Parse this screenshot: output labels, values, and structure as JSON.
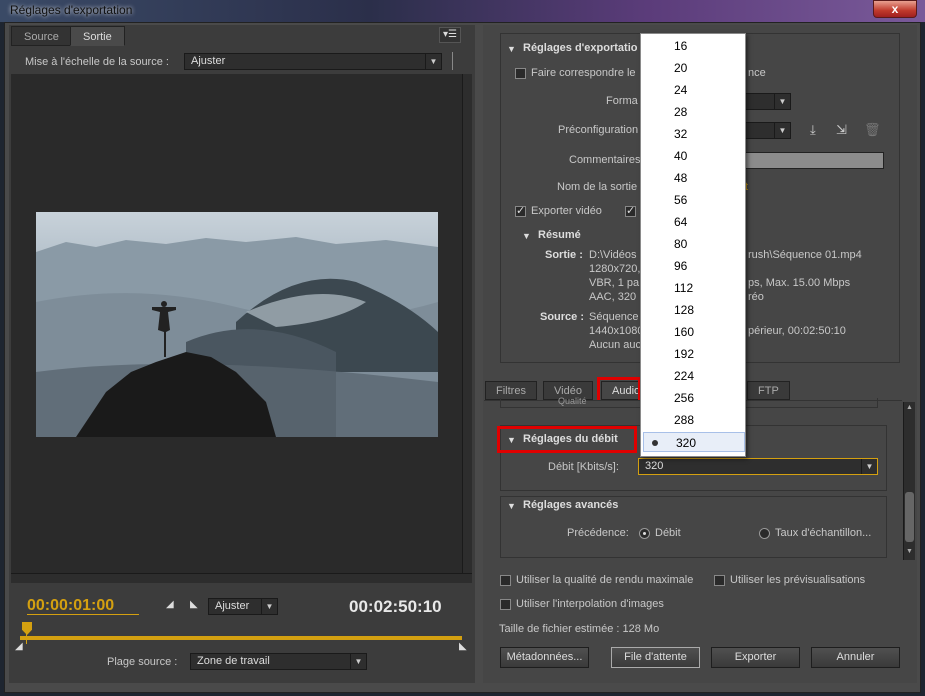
{
  "window": {
    "title": "Réglages d'exportation",
    "close": "x"
  },
  "left": {
    "tabs": [
      "Source",
      "Sortie"
    ],
    "scale_label": "Mise à l'échelle de la source :",
    "scale_value": "Ajuster",
    "timecode_current": "00:00:01:00",
    "timecode_duration": "00:02:50:10",
    "zoom_value": "Ajuster",
    "range_label": "Plage source :",
    "range_value": "Zone de travail"
  },
  "export": {
    "header": "Réglages d'exportatio",
    "match_label": "Faire correspondre le",
    "match_label2": "nce",
    "format_label": "Forma",
    "preset_label": "Préconfiguration",
    "comments_label": "Commentaires",
    "output_name_label": "Nom de la sortie",
    "output_name_val": "t",
    "export_video": "Exporter vidéo",
    "summary_header": "Résumé",
    "output_label": "Sortie :",
    "output_lines": [
      "D:\\Vidéos",
      "1280x720,",
      "VBR, 1 pa",
      "AAC, 320"
    ],
    "output_lines_r": [
      "rush\\Séquence 01.mp4",
      "",
      "ps, Max. 15.00 Mbps",
      "réo"
    ],
    "source_label": "Source :",
    "source_lines": [
      "Séquence",
      "1440x1080",
      "Aucun auc"
    ],
    "source_lines_r": [
      "",
      "périeur, 00:02:50:10",
      ""
    ]
  },
  "tabs2": [
    "Filtres",
    "Vidéo",
    "Audio",
    "FTP"
  ],
  "audio": {
    "cut_label": "Qualité",
    "bitrate_header": "Réglages du débit",
    "bitrate_label": "Débit [Kbits/s]:",
    "bitrate_value": "320",
    "advanced_header": "Réglages avancés",
    "precedence_label": "Précédence:",
    "opt_bitrate": "Débit",
    "opt_sample": "Taux d'échantillon..."
  },
  "popup_items": [
    "16",
    "20",
    "24",
    "28",
    "32",
    "40",
    "48",
    "56",
    "64",
    "80",
    "96",
    "112",
    "128",
    "160",
    "192",
    "224",
    "256",
    "288",
    "320"
  ],
  "popup_selected": "320",
  "bottom": {
    "max_quality": "Utiliser la qualité de rendu maximale",
    "use_previews": "Utiliser les prévisualisations",
    "interp": "Utiliser l'interpolation d'images",
    "filesize": "Taille de fichier estimée : 128 Mo",
    "metadata": "Métadonnées...",
    "queue": "File d'attente",
    "export": "Exporter",
    "cancel": "Annuler"
  },
  "colors": {
    "timecode": "#d4a010",
    "highlight_red": "#e00000"
  }
}
